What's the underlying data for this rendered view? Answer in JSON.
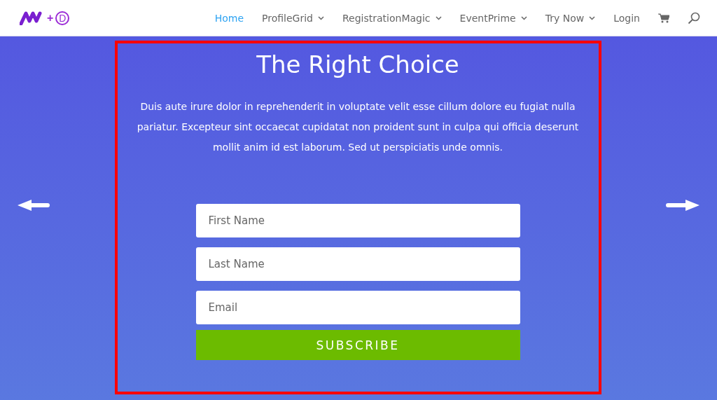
{
  "logo": {
    "plus": "+",
    "letter": "D"
  },
  "nav": [
    {
      "label": "Home",
      "selected": true,
      "dropdown": false
    },
    {
      "label": "ProfileGrid",
      "selected": false,
      "dropdown": true
    },
    {
      "label": "RegistrationMagic",
      "selected": false,
      "dropdown": true
    },
    {
      "label": "EventPrime",
      "selected": false,
      "dropdown": true
    },
    {
      "label": "Try Now",
      "selected": false,
      "dropdown": true
    },
    {
      "label": "Login",
      "selected": false,
      "dropdown": false
    }
  ],
  "hero": {
    "title": "The Right Choice",
    "text": "Duis aute irure dolor in reprehenderit in voluptate velit esse cillum dolore eu fugiat nulla pariatur. Excepteur sint occaecat cupidatat non proident sunt in culpa qui officia deserunt mollit anim id est laborum. Sed ut perspiciatis unde omnis.",
    "fields": [
      {
        "placeholder": "First Name"
      },
      {
        "placeholder": "Last Name"
      },
      {
        "placeholder": "Email"
      }
    ],
    "button": "SUBSCRIBE"
  }
}
